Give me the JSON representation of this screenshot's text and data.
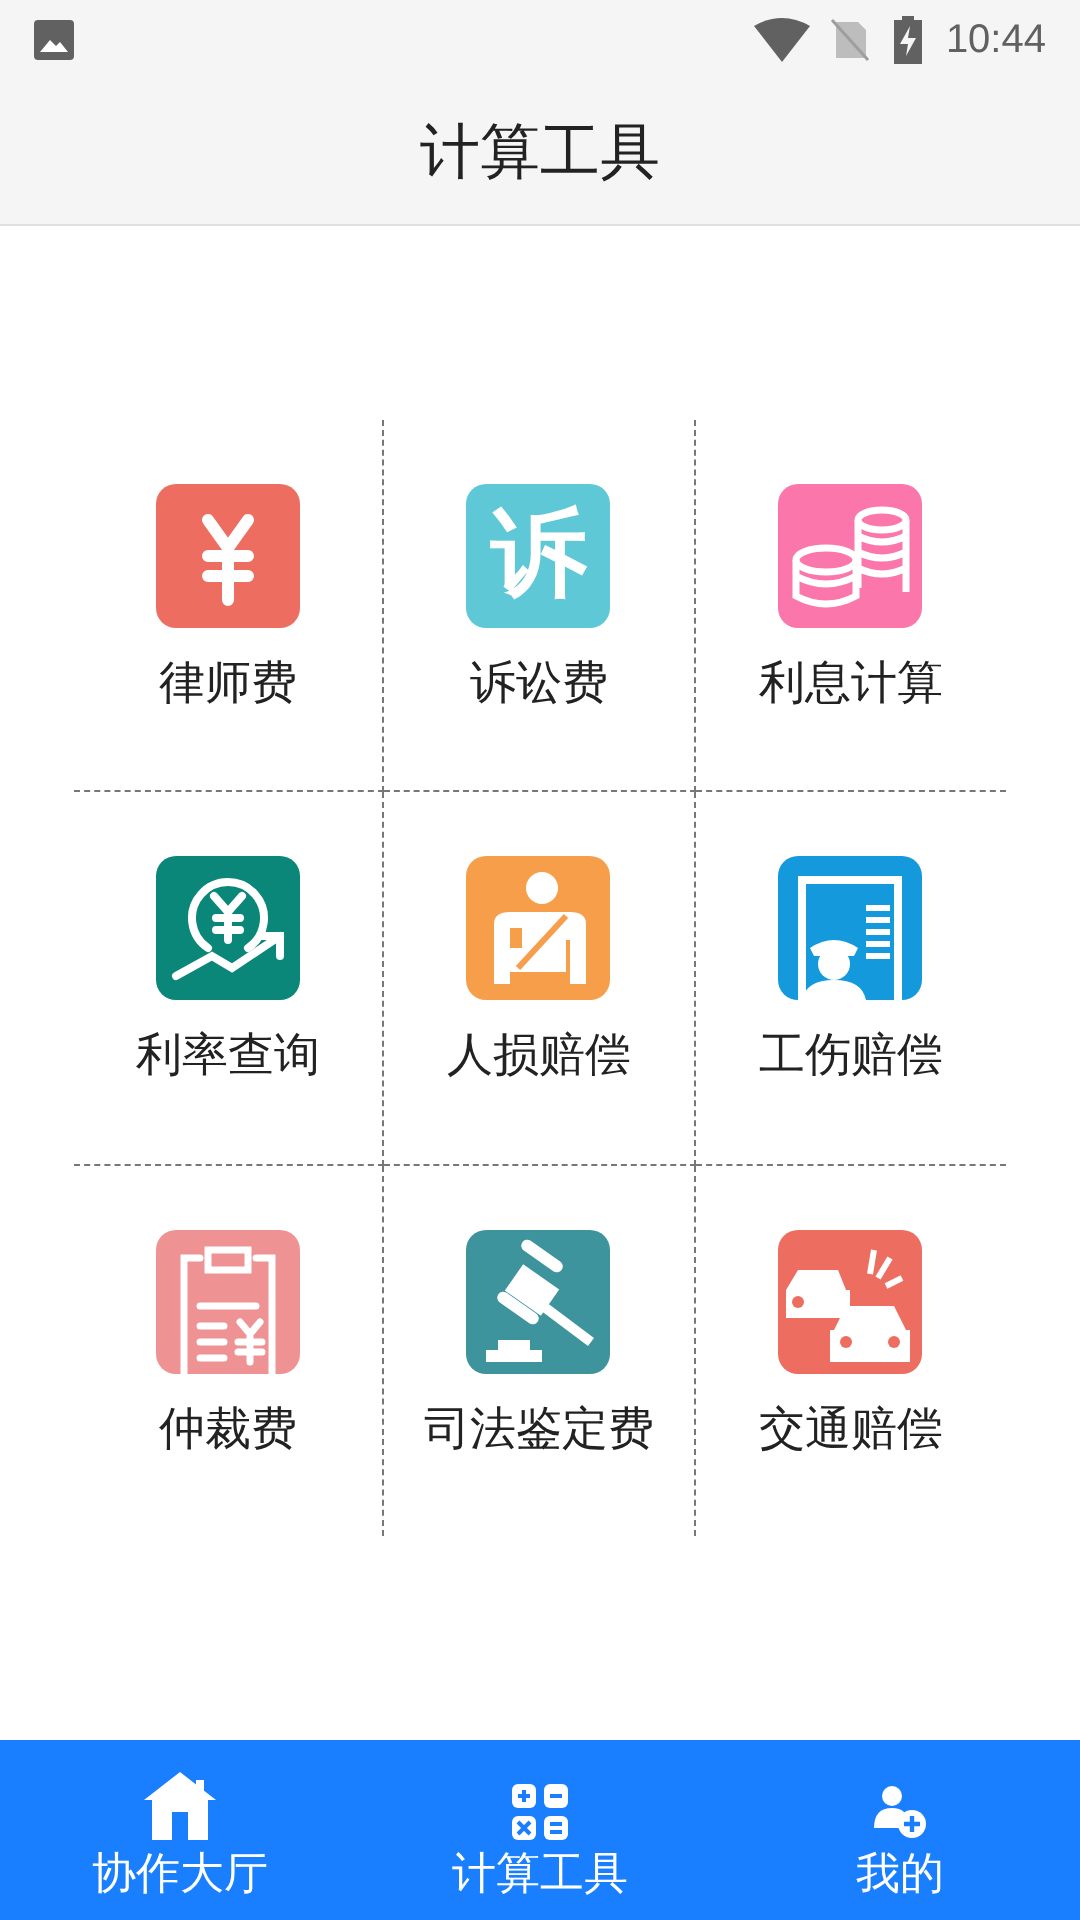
{
  "status_bar": {
    "time": "10:44"
  },
  "header": {
    "title": "计算工具"
  },
  "tool_icons": [
    {
      "kind": "yen",
      "color": "#ed6e60"
    },
    {
      "kind": "glyph",
      "glyph": "诉",
      "color": "#5fc8d6"
    },
    {
      "kind": "coins",
      "color": "#fb76aa"
    },
    {
      "kind": "rate",
      "color": "#0b877a"
    },
    {
      "kind": "injury",
      "color": "#f79e4b"
    },
    {
      "kind": "worker",
      "color": "#1599dd"
    },
    {
      "kind": "clipboard",
      "color": "#ef9293"
    },
    {
      "kind": "gavel",
      "color": "#3e949c"
    },
    {
      "kind": "cars",
      "color": "#ed6e60"
    }
  ],
  "tools": [
    {
      "label": "律师费"
    },
    {
      "label": "诉讼费"
    },
    {
      "label": "利息计算"
    },
    {
      "label": "利率查询"
    },
    {
      "label": "人损赔偿"
    },
    {
      "label": "工伤赔偿"
    },
    {
      "label": "仲裁费"
    },
    {
      "label": "司法鉴定费"
    },
    {
      "label": "交通赔偿"
    }
  ],
  "bottom_nav": [
    {
      "label": "协作大厅",
      "kind": "home"
    },
    {
      "label": "计算工具",
      "kind": "calc"
    },
    {
      "label": "我的",
      "kind": "user"
    }
  ]
}
